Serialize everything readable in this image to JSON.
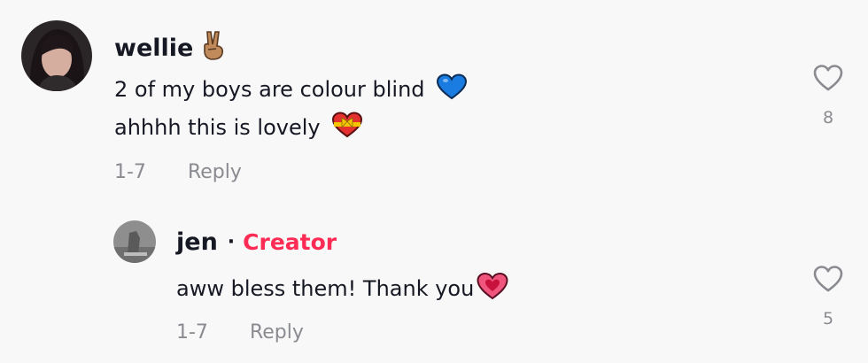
{
  "comments": [
    {
      "username": "wellie",
      "username_emoji": "victory-hand-emoji",
      "lines": [
        {
          "text": "2 of my boys are colour blind",
          "emoji": "blue-heart-emoji"
        },
        {
          "text": "ahhhh this is lovely",
          "emoji": "heart-ribbon-emoji"
        }
      ],
      "date": "1-7",
      "reply_label": "Reply",
      "like_count": "8"
    },
    {
      "username": "jen",
      "separator": "·",
      "badge": "Creator",
      "lines": [
        {
          "text": "aww bless them! Thank you",
          "emoji": "sparkling-heart-emoji"
        }
      ],
      "date": "1-7",
      "reply_label": "Reply",
      "like_count": "5"
    }
  ],
  "colors": {
    "background": "#f8f8f8",
    "text": "#161823",
    "muted": "#8a8b91",
    "creator": "#fe2c55"
  }
}
